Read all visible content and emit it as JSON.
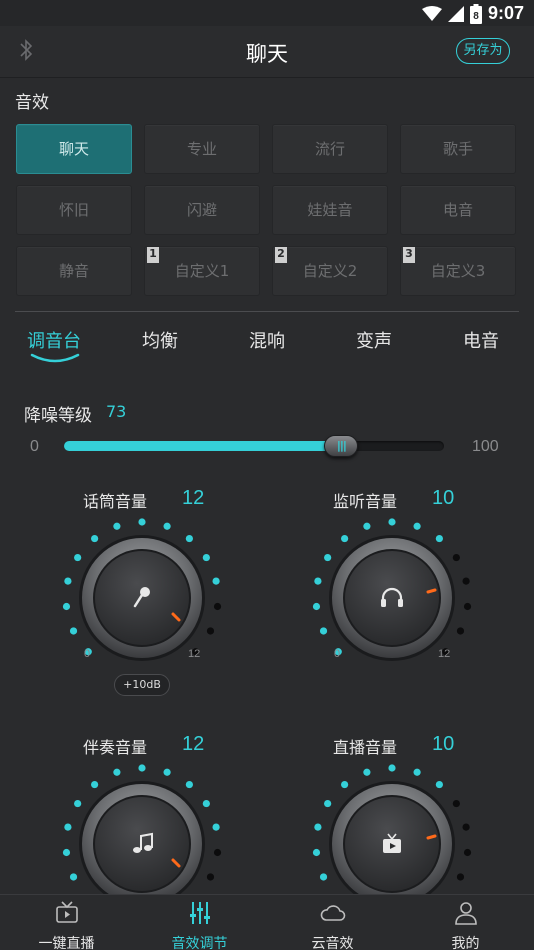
{
  "status": {
    "time": "9:07",
    "battery_level": "8"
  },
  "header": {
    "title": "聊天",
    "save_as": "另存为"
  },
  "effects_label": "音效",
  "presets": [
    "聊天",
    "专业",
    "流行",
    "歌手",
    "怀旧",
    "闪避",
    "娃娃音",
    "电音",
    "静音",
    "自定义1",
    "自定义2",
    "自定义3"
  ],
  "preset_numbers": [
    "1",
    "2",
    "3"
  ],
  "active_preset": "聊天",
  "tabs": [
    "调音台",
    "均衡",
    "混响",
    "变声",
    "电音"
  ],
  "noise": {
    "label": "降噪等级",
    "value": "73",
    "min": "0",
    "max": "100",
    "level": 73
  },
  "knobs": [
    {
      "label": "话筒音量",
      "value": "12",
      "min": "0",
      "max": "12",
      "icon": "microphone-icon"
    },
    {
      "label": "监听音量",
      "value": "10",
      "min": "0",
      "max": "12",
      "icon": "headphones-icon"
    },
    {
      "label": "伴奏音量",
      "value": "12",
      "icon": "music-note-icon"
    },
    {
      "label": "直播音量",
      "value": "10",
      "icon": "tv-play-icon"
    }
  ],
  "boost_label": "+10dB",
  "nav": [
    {
      "label": "一键直播",
      "icon": "tv-icon"
    },
    {
      "label": "音效调节",
      "icon": "equalizer-icon",
      "active": true
    },
    {
      "label": "云音效",
      "icon": "cloud-icon"
    },
    {
      "label": "我的",
      "icon": "user-icon"
    }
  ],
  "colors": {
    "accent": "#35d0d8",
    "background": "#2a2b2d",
    "active_preset": "#1e6f74",
    "knob_indicator": "#ff6a1a"
  }
}
